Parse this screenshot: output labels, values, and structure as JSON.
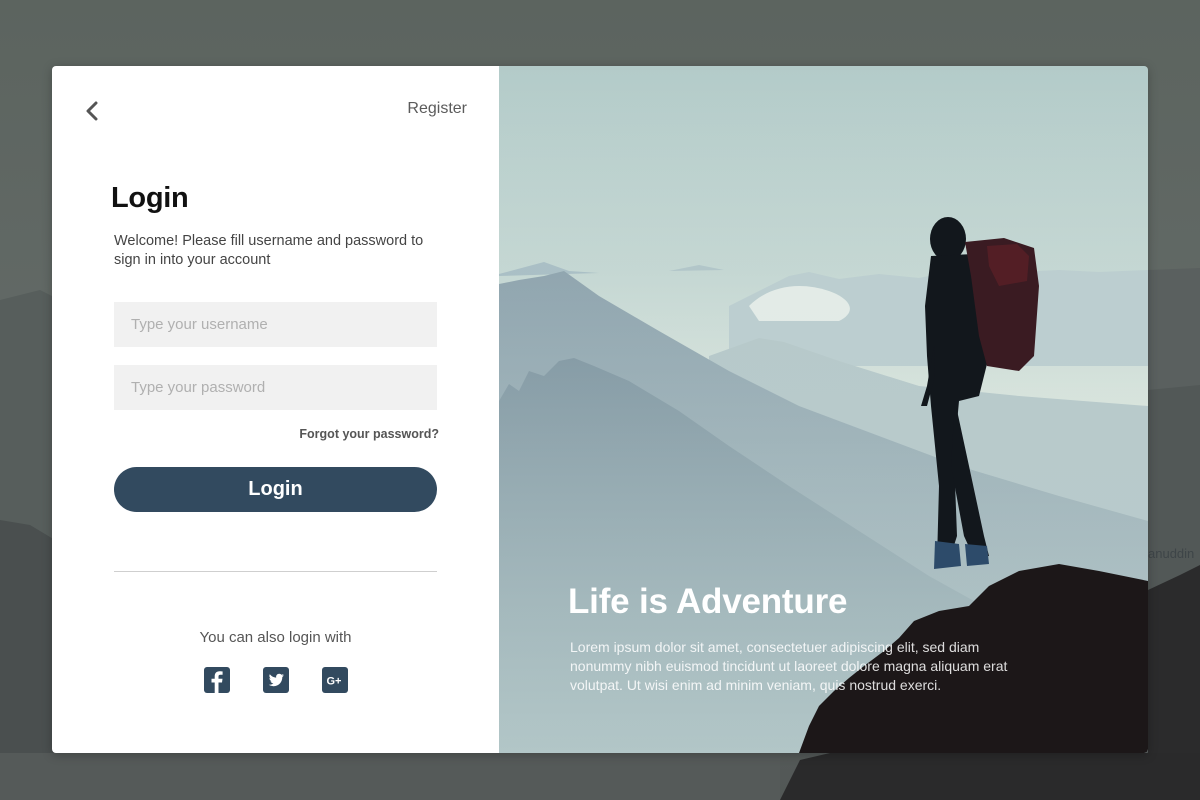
{
  "header": {
    "back_icon": "chevron-left-icon",
    "register_label": "Register"
  },
  "login_form": {
    "title": "Login",
    "subtitle": "Welcome! Please fill username and password to sign in into your account",
    "username": {
      "value": "",
      "placeholder": "Type your username"
    },
    "password": {
      "value": "",
      "placeholder": "Type your password"
    },
    "forgot_label": "Forgot your password?",
    "submit_label": "Login"
  },
  "social_login": {
    "label": "You can also login with",
    "providers": [
      {
        "name": "Facebook",
        "icon": "facebook-icon"
      },
      {
        "name": "Twitter",
        "icon": "twitter-icon"
      },
      {
        "name": "Google Plus",
        "icon": "google-plus-icon"
      }
    ]
  },
  "hero": {
    "headline": "Life is Adventure",
    "body": "Lorem ipsum dolor sit amet, consectetuer adipiscing elit, sed diam nonummy nibh euismod tincidunt ut laoreet dolore magna aliquam erat volutpat. Ut wisi enim ad minim veniam, quis nostrud exerci."
  },
  "background": {
    "watermark": "anuddin"
  },
  "colors": {
    "accent": "#324a5f",
    "input_bg": "#f1f1f1",
    "backdrop": "#5a605c"
  }
}
